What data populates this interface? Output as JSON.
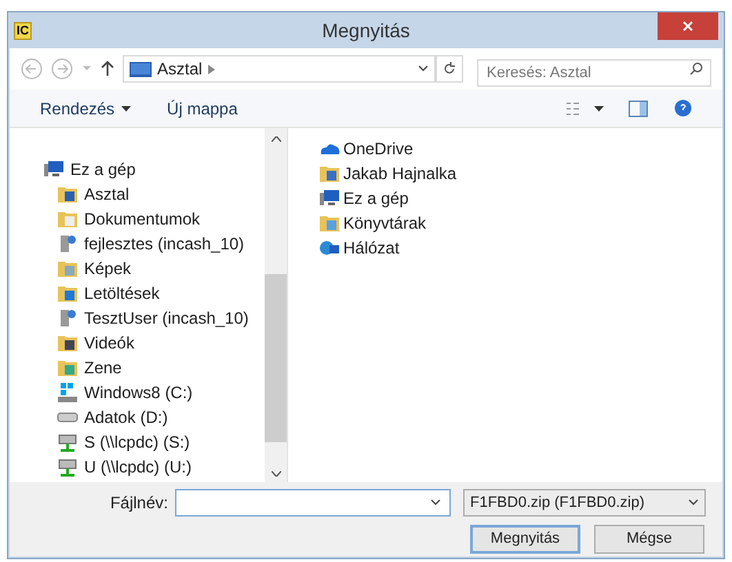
{
  "window": {
    "title": "Megnyitás",
    "app_icon": "IC"
  },
  "address_bar": {
    "location": "Asztal",
    "search_placeholder": "Keresés: Asztal"
  },
  "toolbar": {
    "organize": "Rendezés",
    "new_folder": "Új mappa"
  },
  "sidebar": {
    "items": [
      {
        "label": "Ez a gép",
        "kind": "computer",
        "children": [
          {
            "label": "Asztal",
            "kind": "desktop"
          },
          {
            "label": "Dokumentumok",
            "kind": "docs"
          },
          {
            "label": "fejlesztes (incash_10)",
            "kind": "share"
          },
          {
            "label": "Képek",
            "kind": "pictures"
          },
          {
            "label": "Letöltések",
            "kind": "downloads"
          },
          {
            "label": "TesztUser (incash_10)",
            "kind": "share"
          },
          {
            "label": "Videók",
            "kind": "videos"
          },
          {
            "label": "Zene",
            "kind": "music"
          },
          {
            "label": "Windows8 (C:)",
            "kind": "system"
          },
          {
            "label": "Adatok (D:)",
            "kind": "drive"
          },
          {
            "label": "S (\\\\lcpdc) (S:)",
            "kind": "netdrive"
          },
          {
            "label": "U (\\\\lcpdc) (U:)",
            "kind": "netdrive"
          }
        ]
      }
    ]
  },
  "files": [
    {
      "label": "OneDrive",
      "kind": "cloud"
    },
    {
      "label": "Jakab Hajnalka",
      "kind": "user"
    },
    {
      "label": "Ez a gép",
      "kind": "computer"
    },
    {
      "label": "Könyvtárak",
      "kind": "libraries"
    },
    {
      "label": "Hálózat",
      "kind": "network"
    }
  ],
  "footer": {
    "filename_label": "Fájlnév:",
    "filter": "F1FBD0.zip (F1FBD0.zip)",
    "buttons": [
      {
        "label": "Megnyitás",
        "kind": "default"
      },
      {
        "label": "Mégse",
        "kind": "normal"
      }
    ]
  }
}
